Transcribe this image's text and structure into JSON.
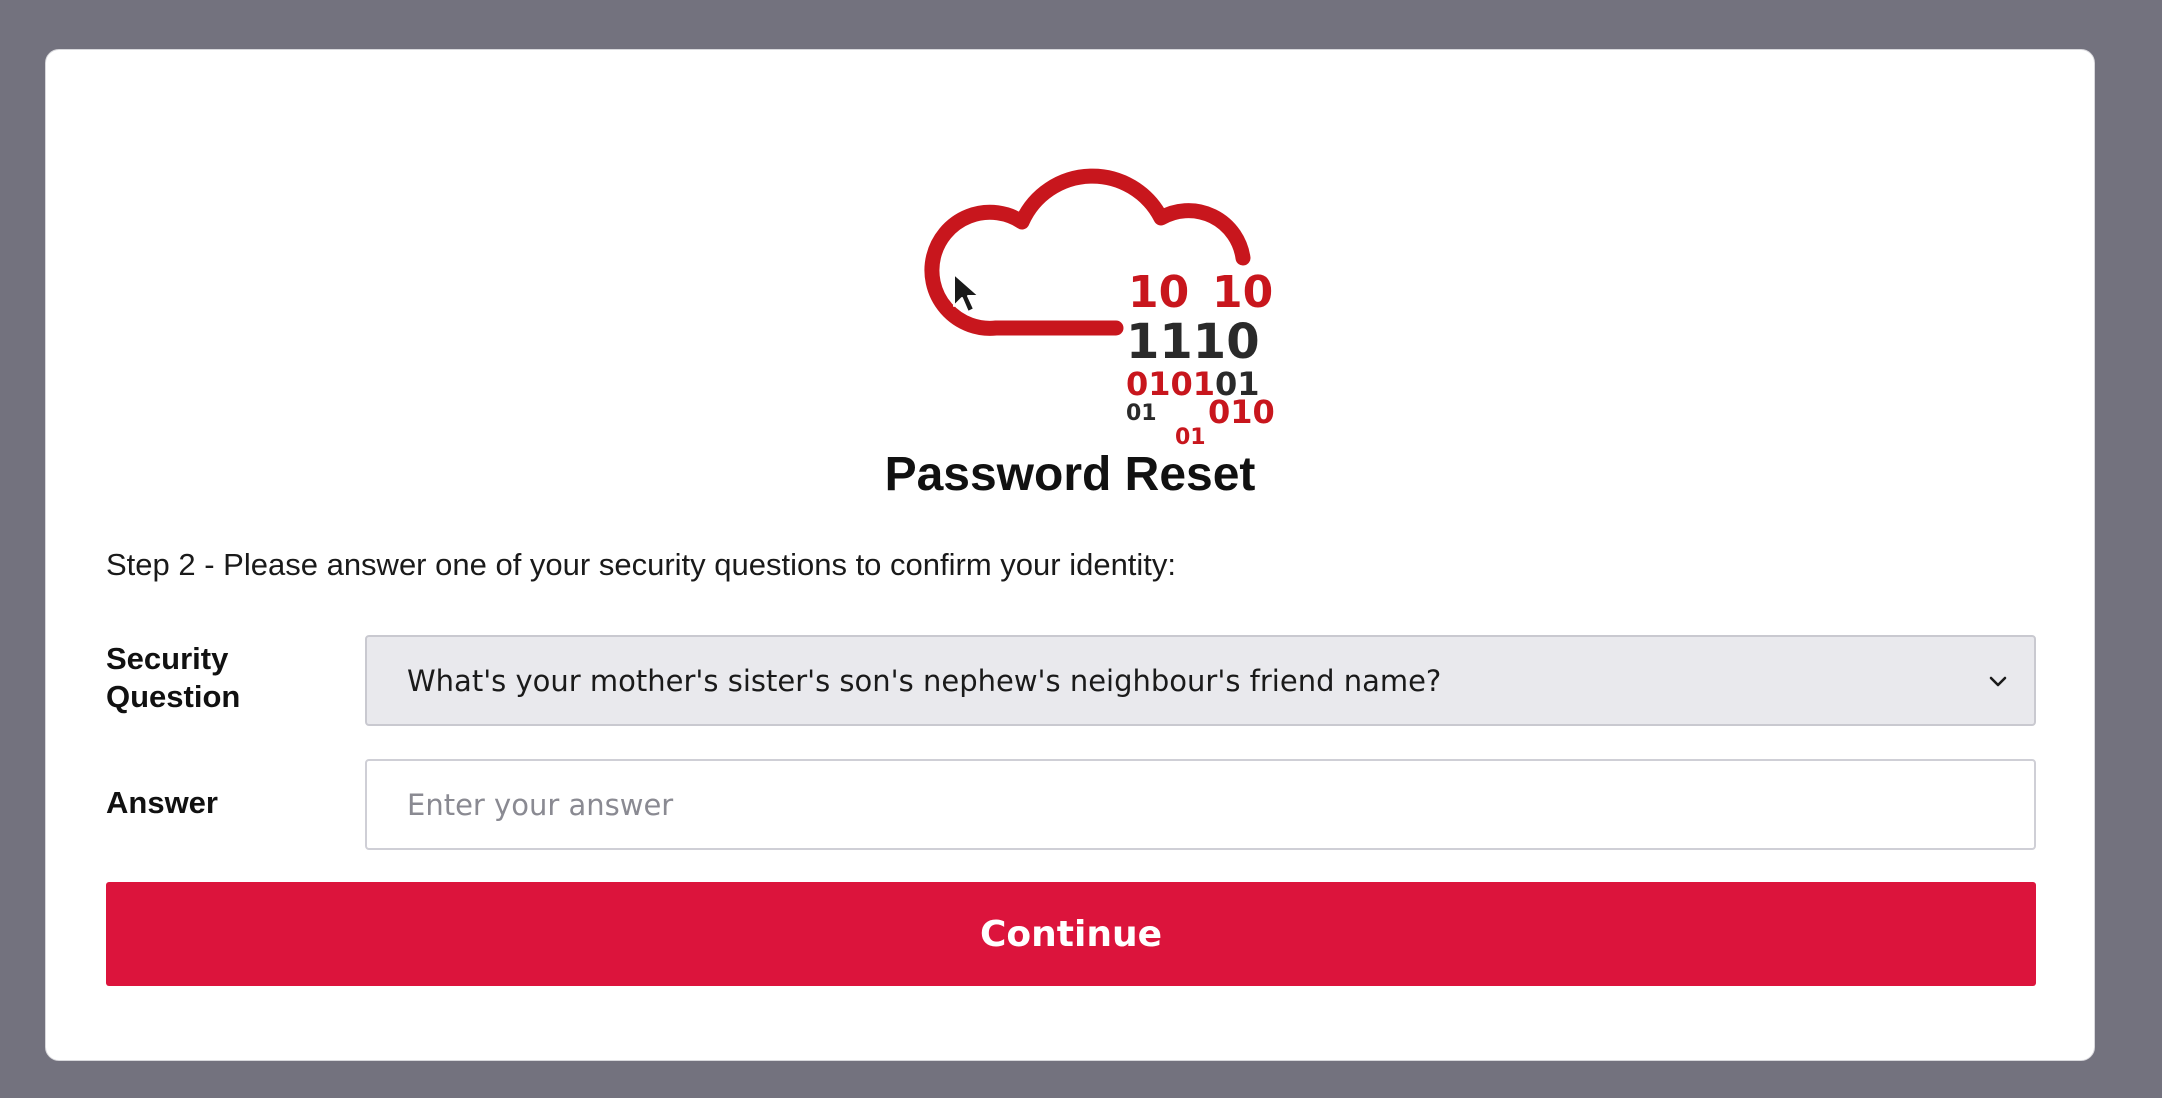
{
  "page": {
    "title": "Password Reset",
    "step_text": "Step 2 - Please answer one of your security questions to confirm your identity:"
  },
  "logo": {
    "icon": "cloud-binary-logo",
    "digits": [
      "10",
      "10",
      "1110",
      "0101",
      "01",
      "01",
      "010",
      "01"
    ],
    "accent_color": "#c8161d",
    "dark_color": "#2a2a2a"
  },
  "form": {
    "security_question": {
      "label": "Security Question",
      "selected": "What's your mother's sister's son's nephew's neighbour's friend name?"
    },
    "answer": {
      "label": "Answer",
      "value": "",
      "placeholder": "Enter your answer"
    },
    "continue_label": "Continue"
  },
  "colors": {
    "background": "#73727e",
    "card": "#ffffff",
    "button": "#dc143c",
    "select_bg": "#e9e9ed"
  }
}
